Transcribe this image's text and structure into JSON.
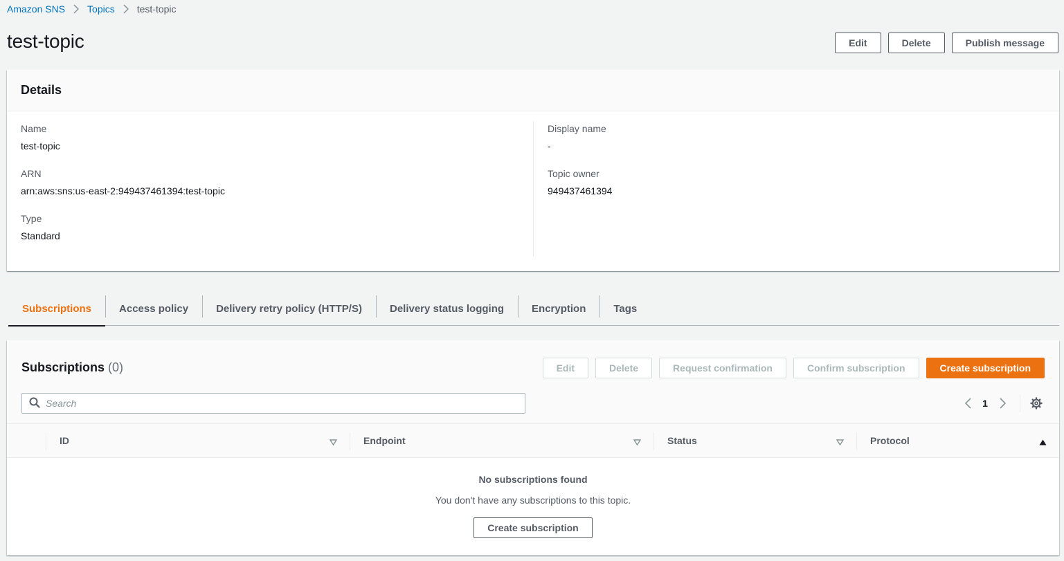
{
  "breadcrumb": {
    "items": [
      "Amazon SNS",
      "Topics"
    ],
    "current": "test-topic"
  },
  "page": {
    "title": "test-topic",
    "actions": {
      "edit": "Edit",
      "delete": "Delete",
      "publish": "Publish message"
    }
  },
  "details": {
    "title": "Details",
    "left": [
      {
        "key": "Name",
        "value": "test-topic"
      },
      {
        "key": "ARN",
        "value": "arn:aws:sns:us-east-2:949437461394:test-topic"
      },
      {
        "key": "Type",
        "value": "Standard"
      }
    ],
    "right": [
      {
        "key": "Display name",
        "value": "-"
      },
      {
        "key": "Topic owner",
        "value": "949437461394"
      }
    ]
  },
  "tabs": [
    {
      "label": "Subscriptions",
      "active": true
    },
    {
      "label": "Access policy"
    },
    {
      "label": "Delivery retry policy (HTTP/S)"
    },
    {
      "label": "Delivery status logging"
    },
    {
      "label": "Encryption"
    },
    {
      "label": "Tags"
    }
  ],
  "subscriptions": {
    "title": "Subscriptions",
    "count": "(0)",
    "actions": {
      "edit": "Edit",
      "delete": "Delete",
      "request_confirmation": "Request confirmation",
      "confirm_subscription": "Confirm subscription",
      "create": "Create subscription"
    },
    "search_placeholder": "Search",
    "page": "1",
    "columns": [
      "ID",
      "Endpoint",
      "Status",
      "Protocol"
    ],
    "empty": {
      "title": "No subscriptions found",
      "message": "You don't have any subscriptions to this topic.",
      "button": "Create subscription"
    }
  },
  "colors": {
    "accent": "#ec7211",
    "link": "#0073bb",
    "text": "#16191f",
    "muted": "#545b64"
  }
}
